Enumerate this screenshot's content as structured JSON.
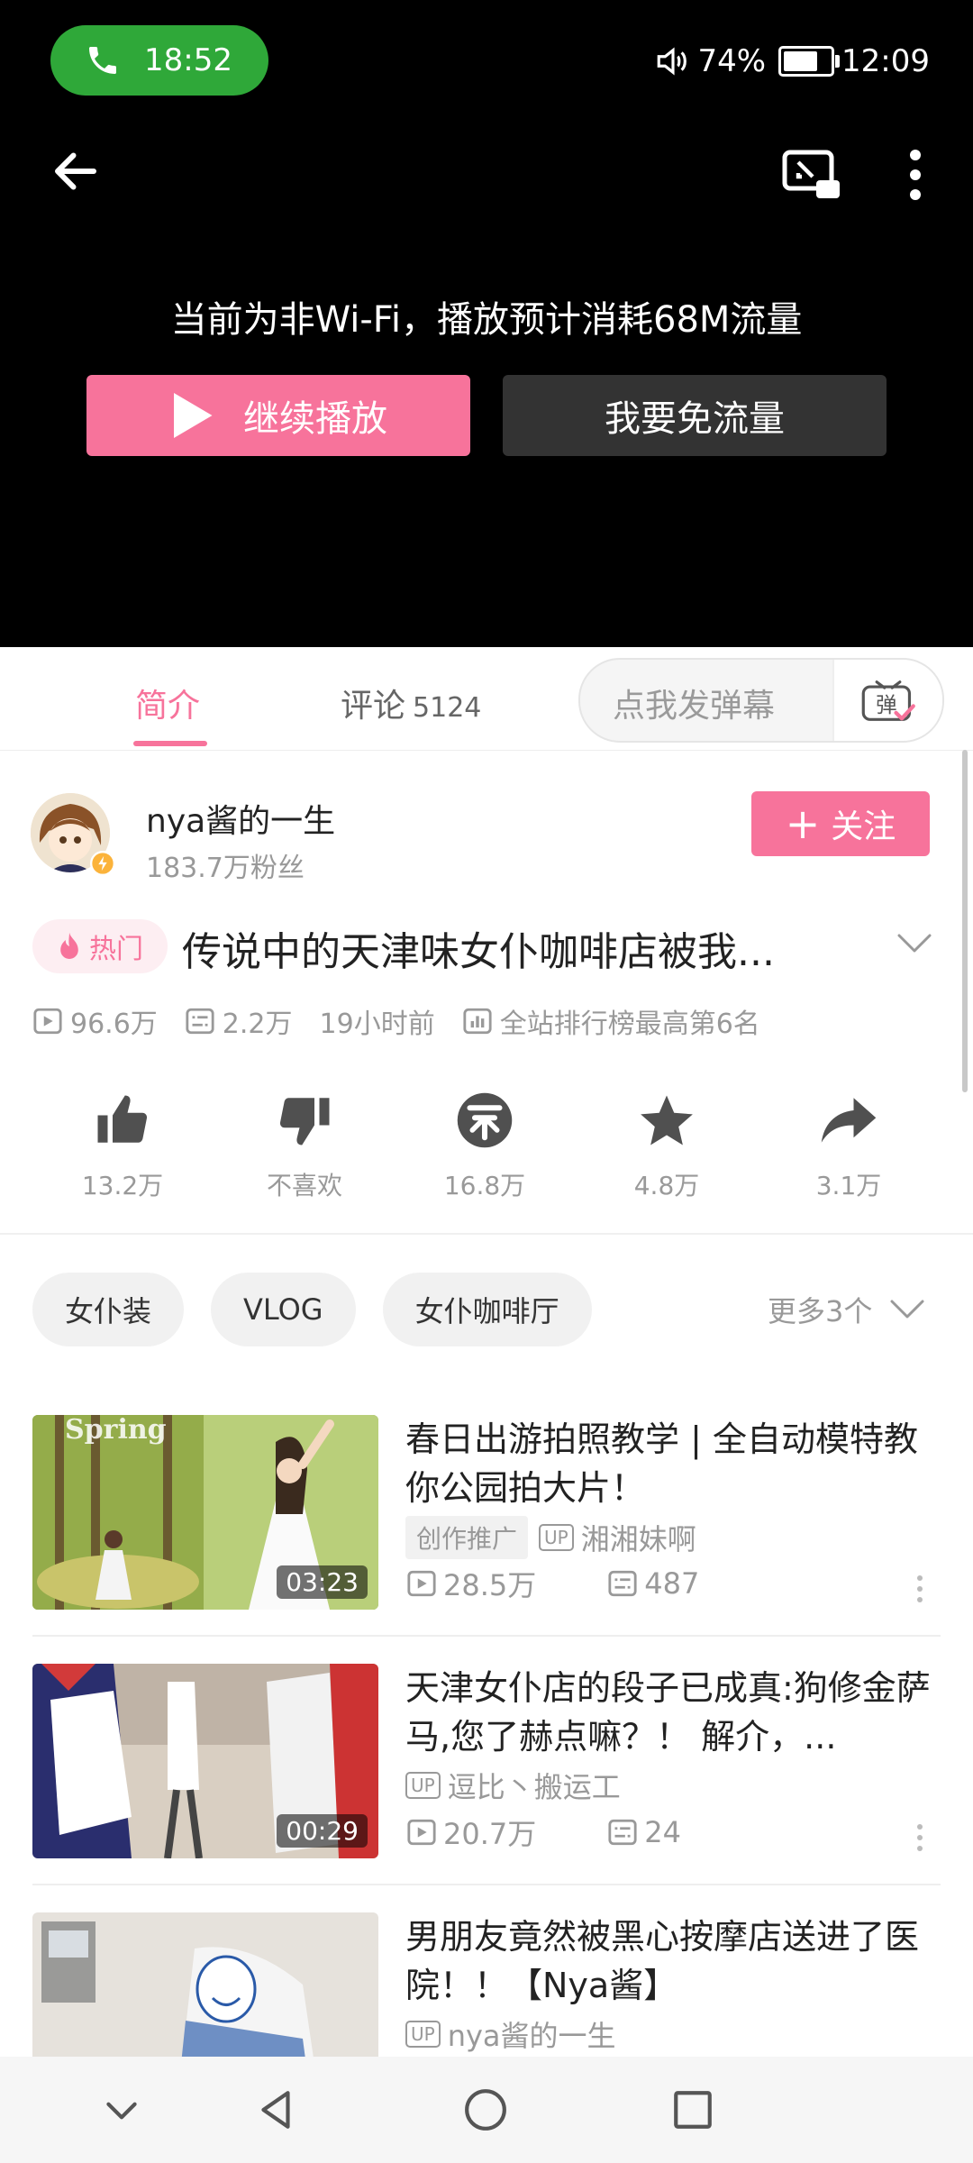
{
  "status_bar": {
    "call_time": "18:52",
    "battery": "74%",
    "battery_level": 0.74,
    "clock": "12:09"
  },
  "player": {
    "notice": "当前为非Wi-Fi，播放预计消耗68M流量",
    "continue_label": "继续播放",
    "free_label": "我要免流量"
  },
  "tabs": {
    "intro": "简介",
    "comments": "评论",
    "comments_count": "5124",
    "danmaku_placeholder": "点我发弹幕"
  },
  "uploader": {
    "name": "nya酱的一生",
    "fans": "183.7万粉丝",
    "follow_label": "关注"
  },
  "video": {
    "hot_badge": "热门",
    "title": "传说中的天津味女仆咖啡店被我...",
    "plays": "96.6万",
    "danmaku": "2.2万",
    "time": "19小时前",
    "rank": "全站排行榜最高第6名"
  },
  "actions": [
    {
      "label": "13.2万"
    },
    {
      "label": "不喜欢"
    },
    {
      "label": "16.8万"
    },
    {
      "label": "4.8万"
    },
    {
      "label": "3.1万"
    }
  ],
  "tags": [
    "女仆装",
    "VLOG",
    "女仆咖啡厅"
  ],
  "more_tags": "更多3个",
  "related": [
    {
      "title": "春日出游拍照教学 | 全自动模特教你公园拍大片！",
      "promo": "创作推广",
      "up_badge": "UP",
      "up": "湘湘妹啊",
      "plays": "28.5万",
      "danmaku": "487",
      "duration": "03:23",
      "thumb_text": "Spring"
    },
    {
      "title": "天津女仆店的段子已成真:狗修金萨马,您了赫点嘛？！ 解介，...",
      "up_badge": "UP",
      "up": "逗比丶搬运工",
      "plays": "20.7万",
      "danmaku": "24",
      "duration": "00:29"
    },
    {
      "title": "男朋友竟然被黑心按摩店送进了医院！！【Nya酱】",
      "up_badge": "UP",
      "up": "nya酱的一生"
    }
  ]
}
